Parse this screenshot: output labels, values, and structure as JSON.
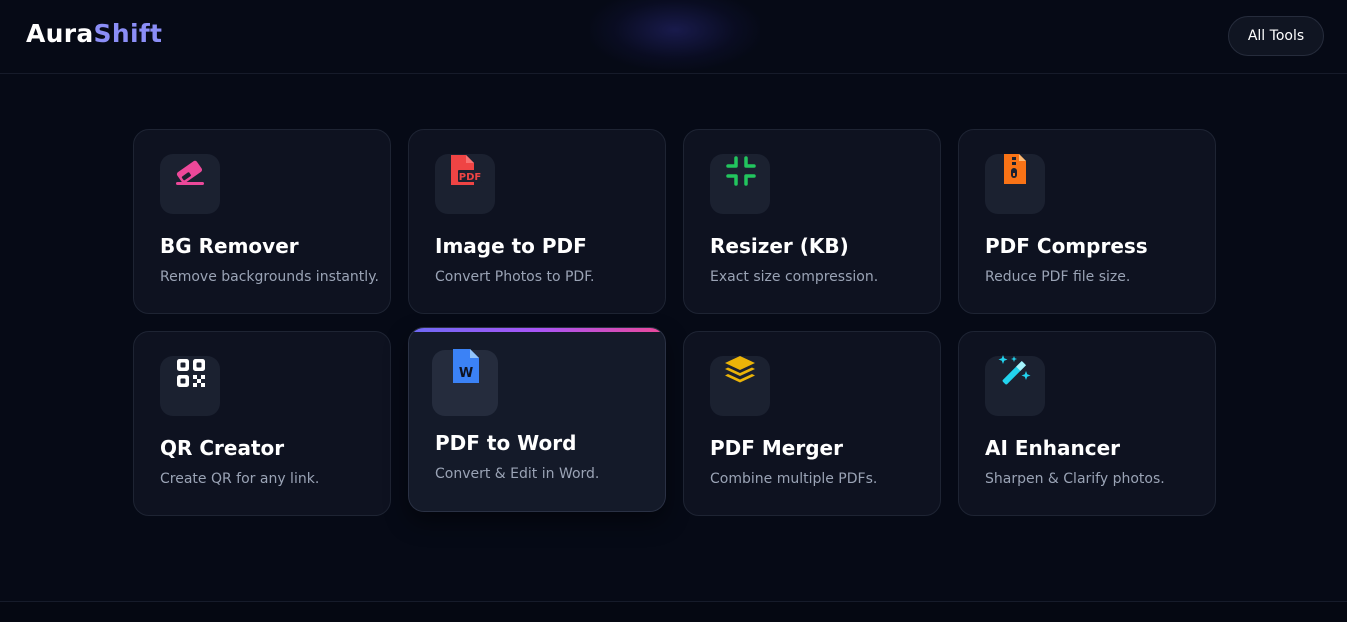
{
  "brand": {
    "part1": "Aura",
    "part2": "Shift"
  },
  "header": {
    "all_tools_label": "All Tools"
  },
  "tools": [
    {
      "title": "BG Remover",
      "desc": "Remove backgrounds instantly.",
      "icon": "eraser-icon",
      "color": "#ec4899"
    },
    {
      "title": "Image to PDF",
      "desc": "Convert Photos to PDF.",
      "icon": "file-pdf-icon",
      "color": "#ef4444"
    },
    {
      "title": "Resizer (KB)",
      "desc": "Exact size compression.",
      "icon": "compress-icon",
      "color": "#22c55e"
    },
    {
      "title": "PDF Compress",
      "desc": "Reduce PDF file size.",
      "icon": "file-zipper-icon",
      "color": "#f97316"
    },
    {
      "title": "QR Creator",
      "desc": "Create QR for any link.",
      "icon": "qrcode-icon",
      "color": "#ffffff"
    },
    {
      "title": "PDF to Word",
      "desc": "Convert & Edit in Word.",
      "icon": "file-word-icon",
      "color": "#3b82f6"
    },
    {
      "title": "PDF Merger",
      "desc": "Combine multiple PDFs.",
      "icon": "layer-group-icon",
      "color": "#eab308"
    },
    {
      "title": "AI Enhancer",
      "desc": "Sharpen & Clarify photos.",
      "icon": "magic-wand-icon",
      "color": "#22d3ee"
    }
  ]
}
